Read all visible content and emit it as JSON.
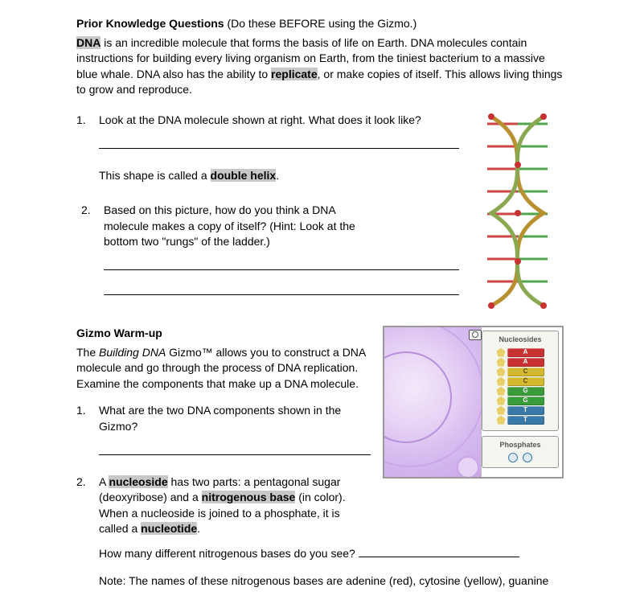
{
  "priorKnowledge": {
    "heading": "Prior Knowledge Questions",
    "headingNote": " (Do these BEFORE using the Gizmo.)",
    "term_dna": "DNA",
    "intro_part1": " is an incredible molecule that forms the basis of life on Earth. DNA molecules contain instructions for building every living organism on Earth, from the tiniest bacterium to a massive blue whale. DNA also has the ability to ",
    "term_replicate": "replicate",
    "intro_part2": ", or make copies of itself. This allows living things to grow and reproduce.",
    "q1_num": "1.",
    "q1_text": "Look at the DNA molecule shown at right. What does it look like?",
    "shape_pre": "This shape is called a ",
    "term_helix": "double helix",
    "period": ".",
    "q2_num": "2.",
    "q2_text": "Based on this picture, how do you think a DNA molecule makes a copy of itself? (Hint: Look at the bottom two \"rungs\" of the ladder.)"
  },
  "warmup": {
    "heading": "Gizmo Warm-up",
    "intro_pre": "The ",
    "intro_italic": "Building DNA",
    "intro_post": " Gizmo™ allows you to construct a DNA molecule and go through the process of DNA replication. Examine the components that make up a DNA molecule.",
    "q1_num": "1.",
    "q1_text": "What are the two DNA components shown in the Gizmo?",
    "q2_num": "2.",
    "q2_pre": "A ",
    "term_nucleoside": "nucleoside",
    "q2_mid1": " has two parts: a pentagonal sugar (deoxyribose) and a ",
    "term_nitro": "nitrogenous base",
    "q2_mid2": " (in color). When a nucleoside is joined to a phosphate, it is called a ",
    "term_nucleotide": "nucleotide",
    "q2_sub": "How many different nitrogenous bases do you see? ",
    "note": "Note: The names of these nitrogenous bases are adenine (red), cytosine (yellow), guanine"
  },
  "gizmo": {
    "nucleosides_title": "Nucleosides",
    "phosphates_title": "Phosphates",
    "bases": [
      "A",
      "A",
      "C",
      "C",
      "G",
      "G",
      "T",
      "T"
    ]
  }
}
